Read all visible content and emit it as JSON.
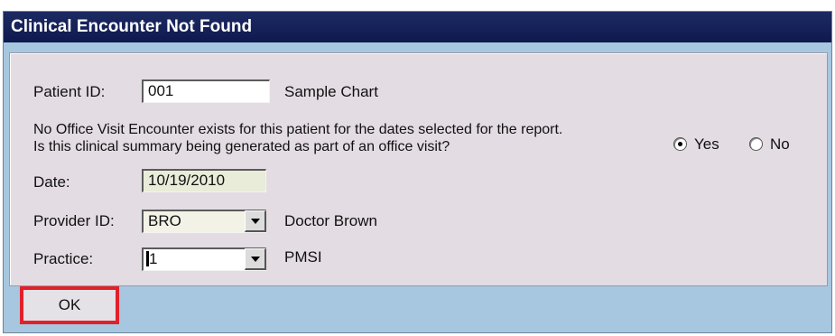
{
  "dialog": {
    "title": "Clinical Encounter Not Found"
  },
  "form": {
    "patient_id_label": "Patient ID:",
    "patient_id_value": "001",
    "patient_name": "Sample Chart",
    "message_line1": "No Office Visit Encounter exists for this patient for the dates selected  for the report.",
    "message_line2": "Is this clinical summary being generated as part of an office visit?",
    "yes_label": "Yes",
    "no_label": "No",
    "selected_option": "Yes",
    "date_label": "Date:",
    "date_value": "10/19/2010",
    "provider_label": "Provider ID:",
    "provider_value": "BRO",
    "provider_name": "Doctor Brown",
    "practice_label": "Practice:",
    "practice_value": "1",
    "practice_name": "PMSI"
  },
  "buttons": {
    "ok_label": "OK"
  }
}
